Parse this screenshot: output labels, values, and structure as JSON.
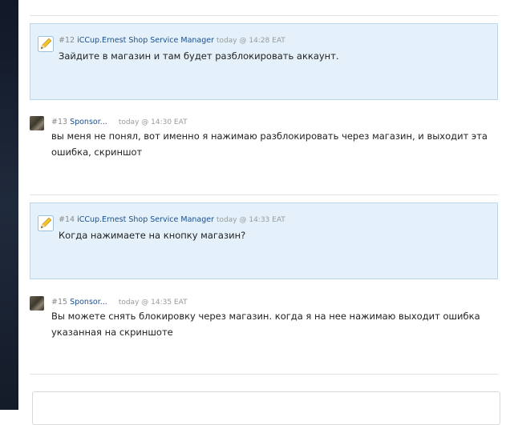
{
  "messages": [
    {
      "number": "#12",
      "author": "iCCup.Ernest Shop Service Manager",
      "time": "today @ 14:28 EAT",
      "text": "Зайдите в магазин и там будет разблокировать аккаунт.",
      "role": "staff"
    },
    {
      "number": "#13",
      "author": "Sponsor...",
      "time": "today @ 14:30 EAT",
      "text": "вы меня не понял, вот именно я нажимаю разблокировать через магазин, и выходит эта ошибка, скриншот",
      "role": "user"
    },
    {
      "number": "#14",
      "author": "iCCup.Ernest Shop Service Manager",
      "time": "today @ 14:33 EAT",
      "text": "Когда нажимаете на кнопку магазин?",
      "role": "staff"
    },
    {
      "number": "#15",
      "author": "Sponsor...",
      "time": "today @ 14:35 EAT",
      "text": "Вы можете снять блокировку через магазин. когда я на нее нажимаю выходит ошибка указанная на скриншоте",
      "role": "user"
    }
  ],
  "icons": {
    "staff_icon": "pencil-icon",
    "user_icon": "avatar"
  },
  "colors": {
    "staff_bg": "#e4f1fb",
    "staff_border": "#bcd6ea",
    "author_link": "#1d4f8c",
    "sidebar_dark": "#1a2233"
  }
}
